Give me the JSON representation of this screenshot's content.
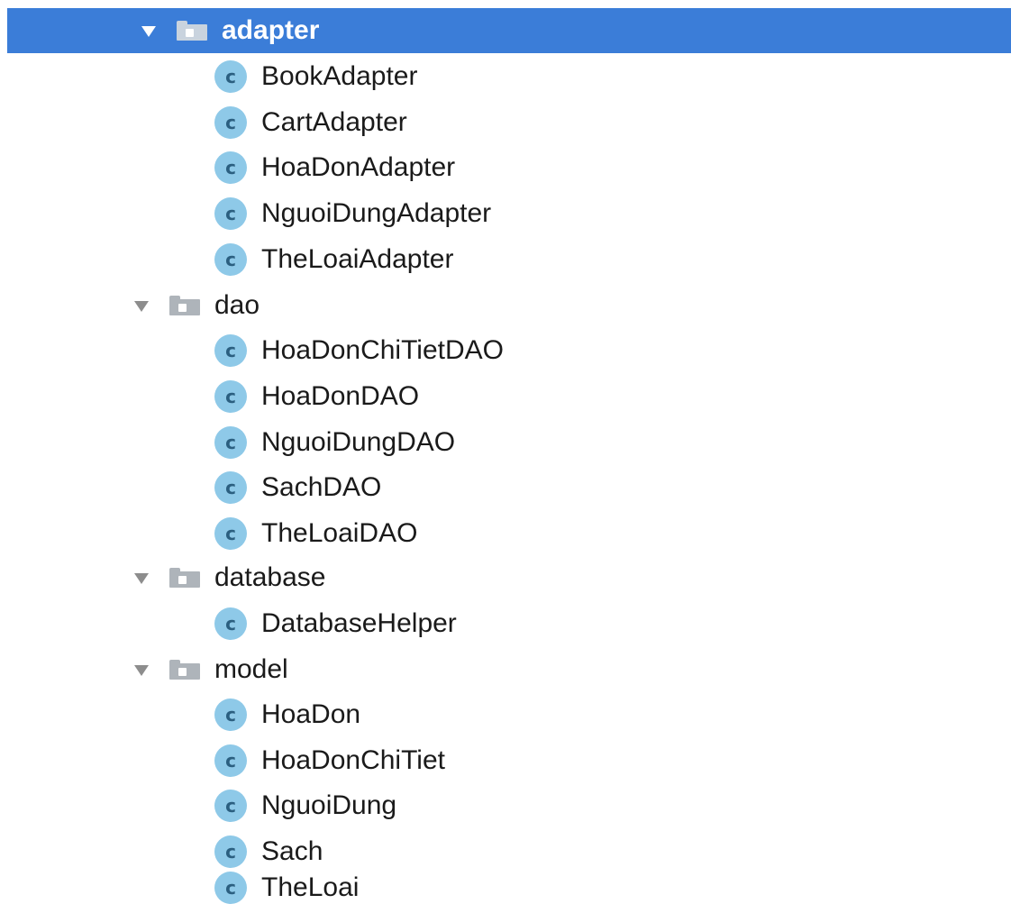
{
  "project_tree": {
    "selected_folder": "adapter",
    "class_icon_letter": "c",
    "accent_color": "#3b7dd8",
    "folders": [
      {
        "name": "adapter",
        "expanded": true,
        "files": [
          "BookAdapter",
          "CartAdapter",
          "HoaDonAdapter",
          "NguoiDungAdapter",
          "TheLoaiAdapter"
        ]
      },
      {
        "name": "dao",
        "expanded": true,
        "files": [
          "HoaDonChiTietDAO",
          "HoaDonDAO",
          "NguoiDungDAO",
          "SachDAO",
          "TheLoaiDAO"
        ]
      },
      {
        "name": "database",
        "expanded": true,
        "files": [
          "DatabaseHelper"
        ]
      },
      {
        "name": "model",
        "expanded": true,
        "files": [
          "HoaDon",
          "HoaDonChiTiet",
          "NguoiDung",
          "Sach",
          "TheLoai"
        ]
      }
    ]
  }
}
